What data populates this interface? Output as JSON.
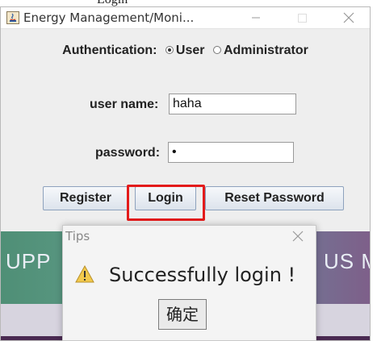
{
  "top_fragment": "Login",
  "window": {
    "title": "Energy Management/Moni...",
    "icon": "java-app-icon",
    "controls": [
      "minimize-icon",
      "maximize-icon",
      "close-icon"
    ]
  },
  "auth": {
    "label": "Authentication:",
    "options": [
      {
        "label": "User",
        "selected": true
      },
      {
        "label": "Administrator",
        "selected": false
      }
    ]
  },
  "form": {
    "username_label": "user name:",
    "username_value": "haha",
    "password_label": "password:",
    "password_value": "•"
  },
  "buttons": {
    "register": "Register",
    "login": "Login",
    "reset": "Reset Password"
  },
  "highlight_color": "#e31b1b",
  "banner": {
    "left_text": "UPP",
    "right_text": "US ME"
  },
  "dialog": {
    "title": "Tips",
    "icon": "warning-icon",
    "message": "Successfully login !",
    "ok_label": "确定"
  }
}
